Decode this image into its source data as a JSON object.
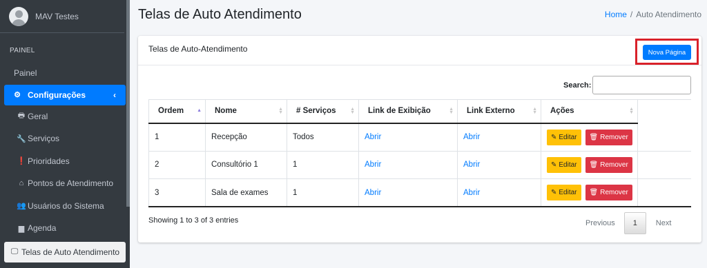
{
  "user": {
    "name": "MAV Testes"
  },
  "sidebar": {
    "header": "PAINEL",
    "items": [
      {
        "label": "Painel",
        "icon": "none"
      },
      {
        "label": "Configurações",
        "icon": "cogs-icon",
        "chevron": "‹"
      },
      {
        "label": "Geral",
        "icon": "print-icon"
      },
      {
        "label": "Serviços",
        "icon": "wrench-icon"
      },
      {
        "label": "Prioridades",
        "icon": "exclamation-circle-icon"
      },
      {
        "label": "Pontos de Atendimento",
        "icon": "home-icon"
      },
      {
        "label": "Usuários do Sistema",
        "icon": "users-icon"
      },
      {
        "label": "Agenda",
        "icon": "book-icon"
      },
      {
        "label": "Telas de Auto Atendimento",
        "icon": "desktop-icon"
      }
    ]
  },
  "page": {
    "title": "Telas de Auto Atendimento"
  },
  "breadcrumb": {
    "home": "Home",
    "separator": "/",
    "current": "Auto Atendimento"
  },
  "card": {
    "title": "Telas de Auto-Atendimento",
    "new_button": "Nova Página"
  },
  "search": {
    "label": "Search:",
    "value": ""
  },
  "table": {
    "columns": [
      "Ordem",
      "Nome",
      "# Serviços",
      "Link de Exibição",
      "Link Externo",
      "Ações"
    ],
    "rows": [
      {
        "ordem": "1",
        "nome": "Recepção",
        "servicos": "Todos",
        "exibicao": "Abrir",
        "externo": "Abrir"
      },
      {
        "ordem": "2",
        "nome": "Consultório 1",
        "servicos": "1",
        "exibicao": "Abrir",
        "externo": "Abrir"
      },
      {
        "ordem": "3",
        "nome": "Sala de exames",
        "servicos": "1",
        "exibicao": "Abrir",
        "externo": "Abrir"
      }
    ],
    "edit_label": "Editar",
    "remove_label": "Remover"
  },
  "footer": {
    "info": "Showing 1 to 3 of 3 entries",
    "previous": "Previous",
    "page": "1",
    "next": "Next"
  },
  "colors": {
    "primary": "#007bff",
    "warning": "#ffc107",
    "danger": "#dc3545",
    "sidebar": "#343a40",
    "highlight": "#d9212a"
  }
}
